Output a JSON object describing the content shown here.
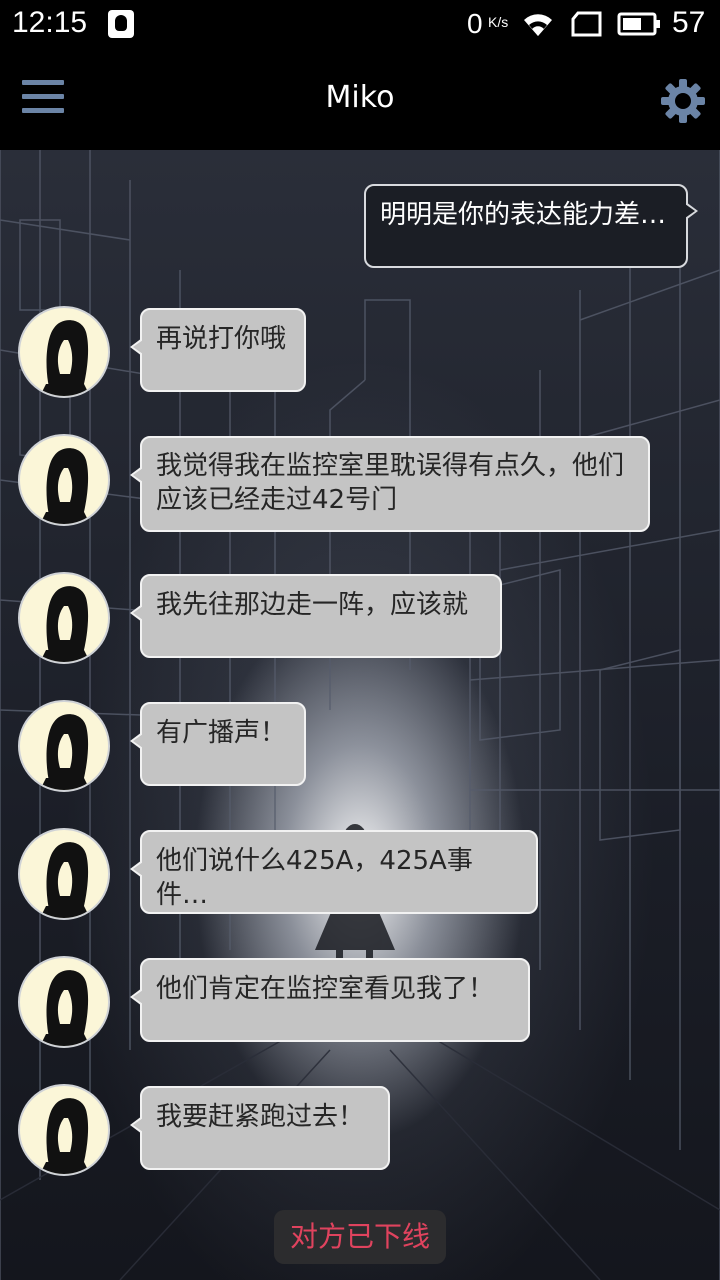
{
  "status_bar": {
    "time": "12:15",
    "net_speed_value": "0",
    "net_speed_unit": "K/s",
    "battery_level": "57"
  },
  "header": {
    "title": "Miko",
    "menu_icon": "hamburger-menu-icon",
    "settings_icon": "gear-icon"
  },
  "messages": [
    {
      "from": "me",
      "text": "明明是你的表达能力差…"
    },
    {
      "from": "miko",
      "text": "再说打你哦"
    },
    {
      "from": "miko",
      "text": "我觉得我在监控室里耽误得有点久，他们应该已经走过42号门"
    },
    {
      "from": "miko",
      "text": "我先往那边走一阵，应该就"
    },
    {
      "from": "miko",
      "text": "有广播声！"
    },
    {
      "from": "miko",
      "text": "他们说什么425A，425A事件…"
    },
    {
      "from": "miko",
      "text": "他们肯定在监控室看见我了！"
    },
    {
      "from": "miko",
      "text": "我要赶紧跑过去！"
    }
  ],
  "footer": {
    "status_text": "对方已下线"
  },
  "colors": {
    "accent_icon": "#6b84a6",
    "offline_text": "#e0435e",
    "incoming_bubble": "#c4c4c4",
    "outgoing_bubble": "#1b1e25"
  }
}
